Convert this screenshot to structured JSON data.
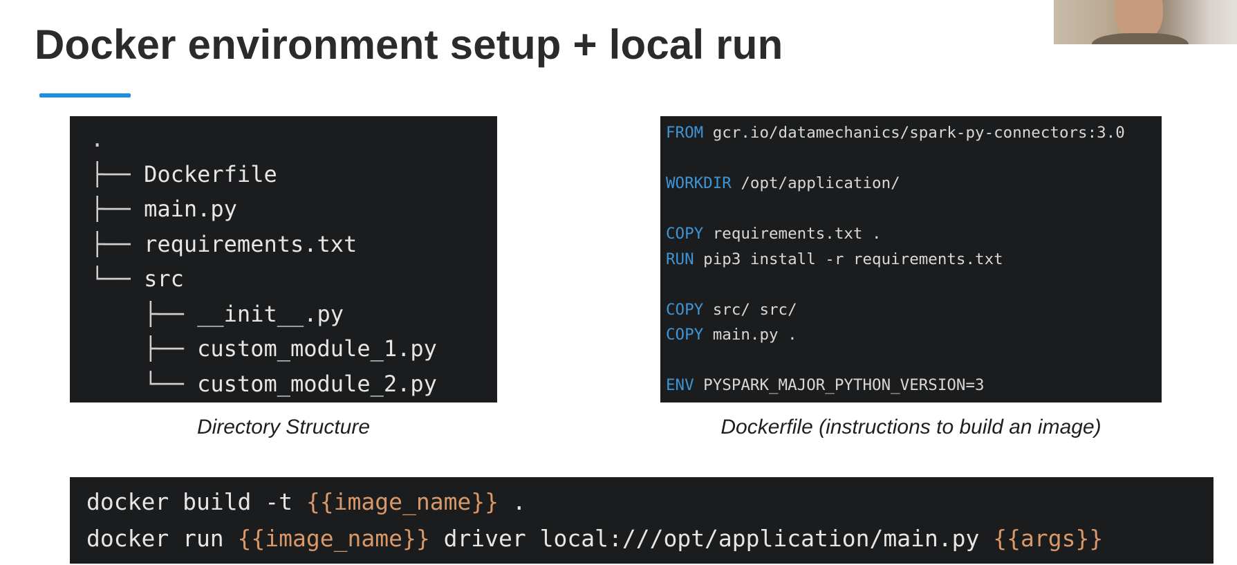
{
  "slide": {
    "title": "Docker environment setup + local run",
    "accent_color": "#1a8fe3"
  },
  "webcam": {
    "description_icon": "presenter-webcam"
  },
  "directory_panel": {
    "lines": [
      {
        "branch": ".",
        "name": ""
      },
      {
        "branch": "├── ",
        "name": "Dockerfile"
      },
      {
        "branch": "├── ",
        "name": "main.py"
      },
      {
        "branch": "├── ",
        "name": "requirements.txt"
      },
      {
        "branch": "└── ",
        "name": "src"
      },
      {
        "branch": "    ├── ",
        "name": "__init__.py"
      },
      {
        "branch": "    ├── ",
        "name": "custom_module_1.py"
      },
      {
        "branch": "    └── ",
        "name": "custom_module_2.py"
      }
    ],
    "caption": "Directory Structure"
  },
  "dockerfile_panel": {
    "lines": [
      {
        "keyword": "FROM",
        "rest": " gcr.io/datamechanics/spark-py-connectors:3.0"
      },
      {
        "keyword": "",
        "rest": ""
      },
      {
        "keyword": "WORKDIR",
        "rest": " /opt/application/"
      },
      {
        "keyword": "",
        "rest": ""
      },
      {
        "keyword": "COPY",
        "rest": " requirements.txt ."
      },
      {
        "keyword": "RUN",
        "rest": " pip3 install -r requirements.txt"
      },
      {
        "keyword": "",
        "rest": ""
      },
      {
        "keyword": "COPY",
        "rest": " src/ src/"
      },
      {
        "keyword": "COPY",
        "rest": " main.py ."
      },
      {
        "keyword": "",
        "rest": ""
      },
      {
        "keyword": "ENV",
        "rest": " PYSPARK_MAJOR_PYTHON_VERSION=3"
      }
    ],
    "caption": "Dockerfile (instructions to build an image)",
    "keyword_color": "#3d95d6"
  },
  "command_panel": {
    "build": {
      "prefix": "docker build -t ",
      "placeholder": "{{image_name}}",
      "suffix": " ."
    },
    "run": {
      "prefix": "docker run ",
      "placeholder": "{{image_name}}",
      "middle": " driver local:///opt/application/main.py ",
      "placeholder2": "{{args}}"
    },
    "placeholder_color": "#d9986a"
  }
}
